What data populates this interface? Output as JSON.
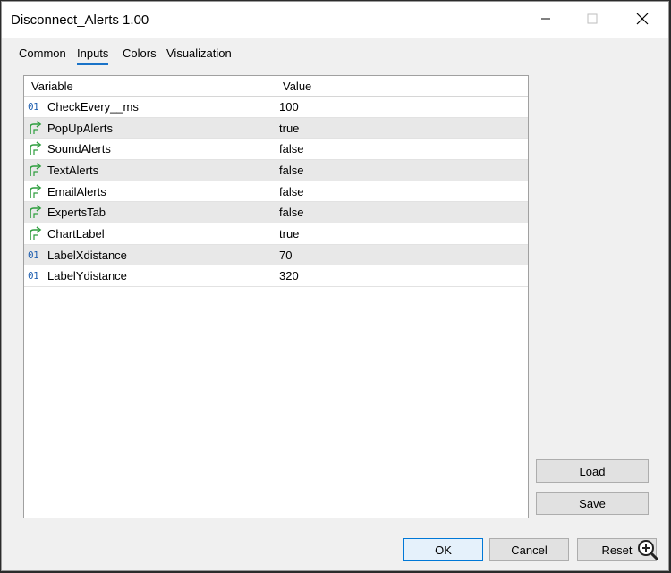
{
  "window": {
    "title": "Disconnect_Alerts 1.00"
  },
  "tabs": [
    {
      "label": "Common"
    },
    {
      "label": "Inputs"
    },
    {
      "label": "Colors"
    },
    {
      "label": "Visualization"
    }
  ],
  "grid": {
    "columns": [
      "Variable",
      "Value"
    ],
    "rows": [
      {
        "name": "CheckEvery__ms",
        "value": "100",
        "icon": "number-icon"
      },
      {
        "name": "PopUpAlerts",
        "value": "true",
        "icon": "bool-arrow-icon"
      },
      {
        "name": "SoundAlerts",
        "value": "false",
        "icon": "bool-arrow-icon"
      },
      {
        "name": "TextAlerts",
        "value": "false",
        "icon": "bool-arrow-icon"
      },
      {
        "name": "EmailAlerts",
        "value": "false",
        "icon": "bool-arrow-icon"
      },
      {
        "name": "ExpertsTab",
        "value": "false",
        "icon": "bool-arrow-icon"
      },
      {
        "name": "ChartLabel",
        "value": "true",
        "icon": "bool-arrow-icon"
      },
      {
        "name": "LabelXdistance",
        "value": "70",
        "icon": "number-icon"
      },
      {
        "name": "LabelYdistance",
        "value": "320",
        "icon": "number-icon"
      }
    ],
    "number_icon_text": "01"
  },
  "side_buttons": {
    "load": "Load",
    "save": "Save"
  },
  "footer": {
    "ok": "OK",
    "cancel": "Cancel",
    "reset": "Reset"
  },
  "colors": {
    "accent": "#1a73c8",
    "bool_icon": "#2e9e3e",
    "number_icon": "#1f5fb0"
  }
}
